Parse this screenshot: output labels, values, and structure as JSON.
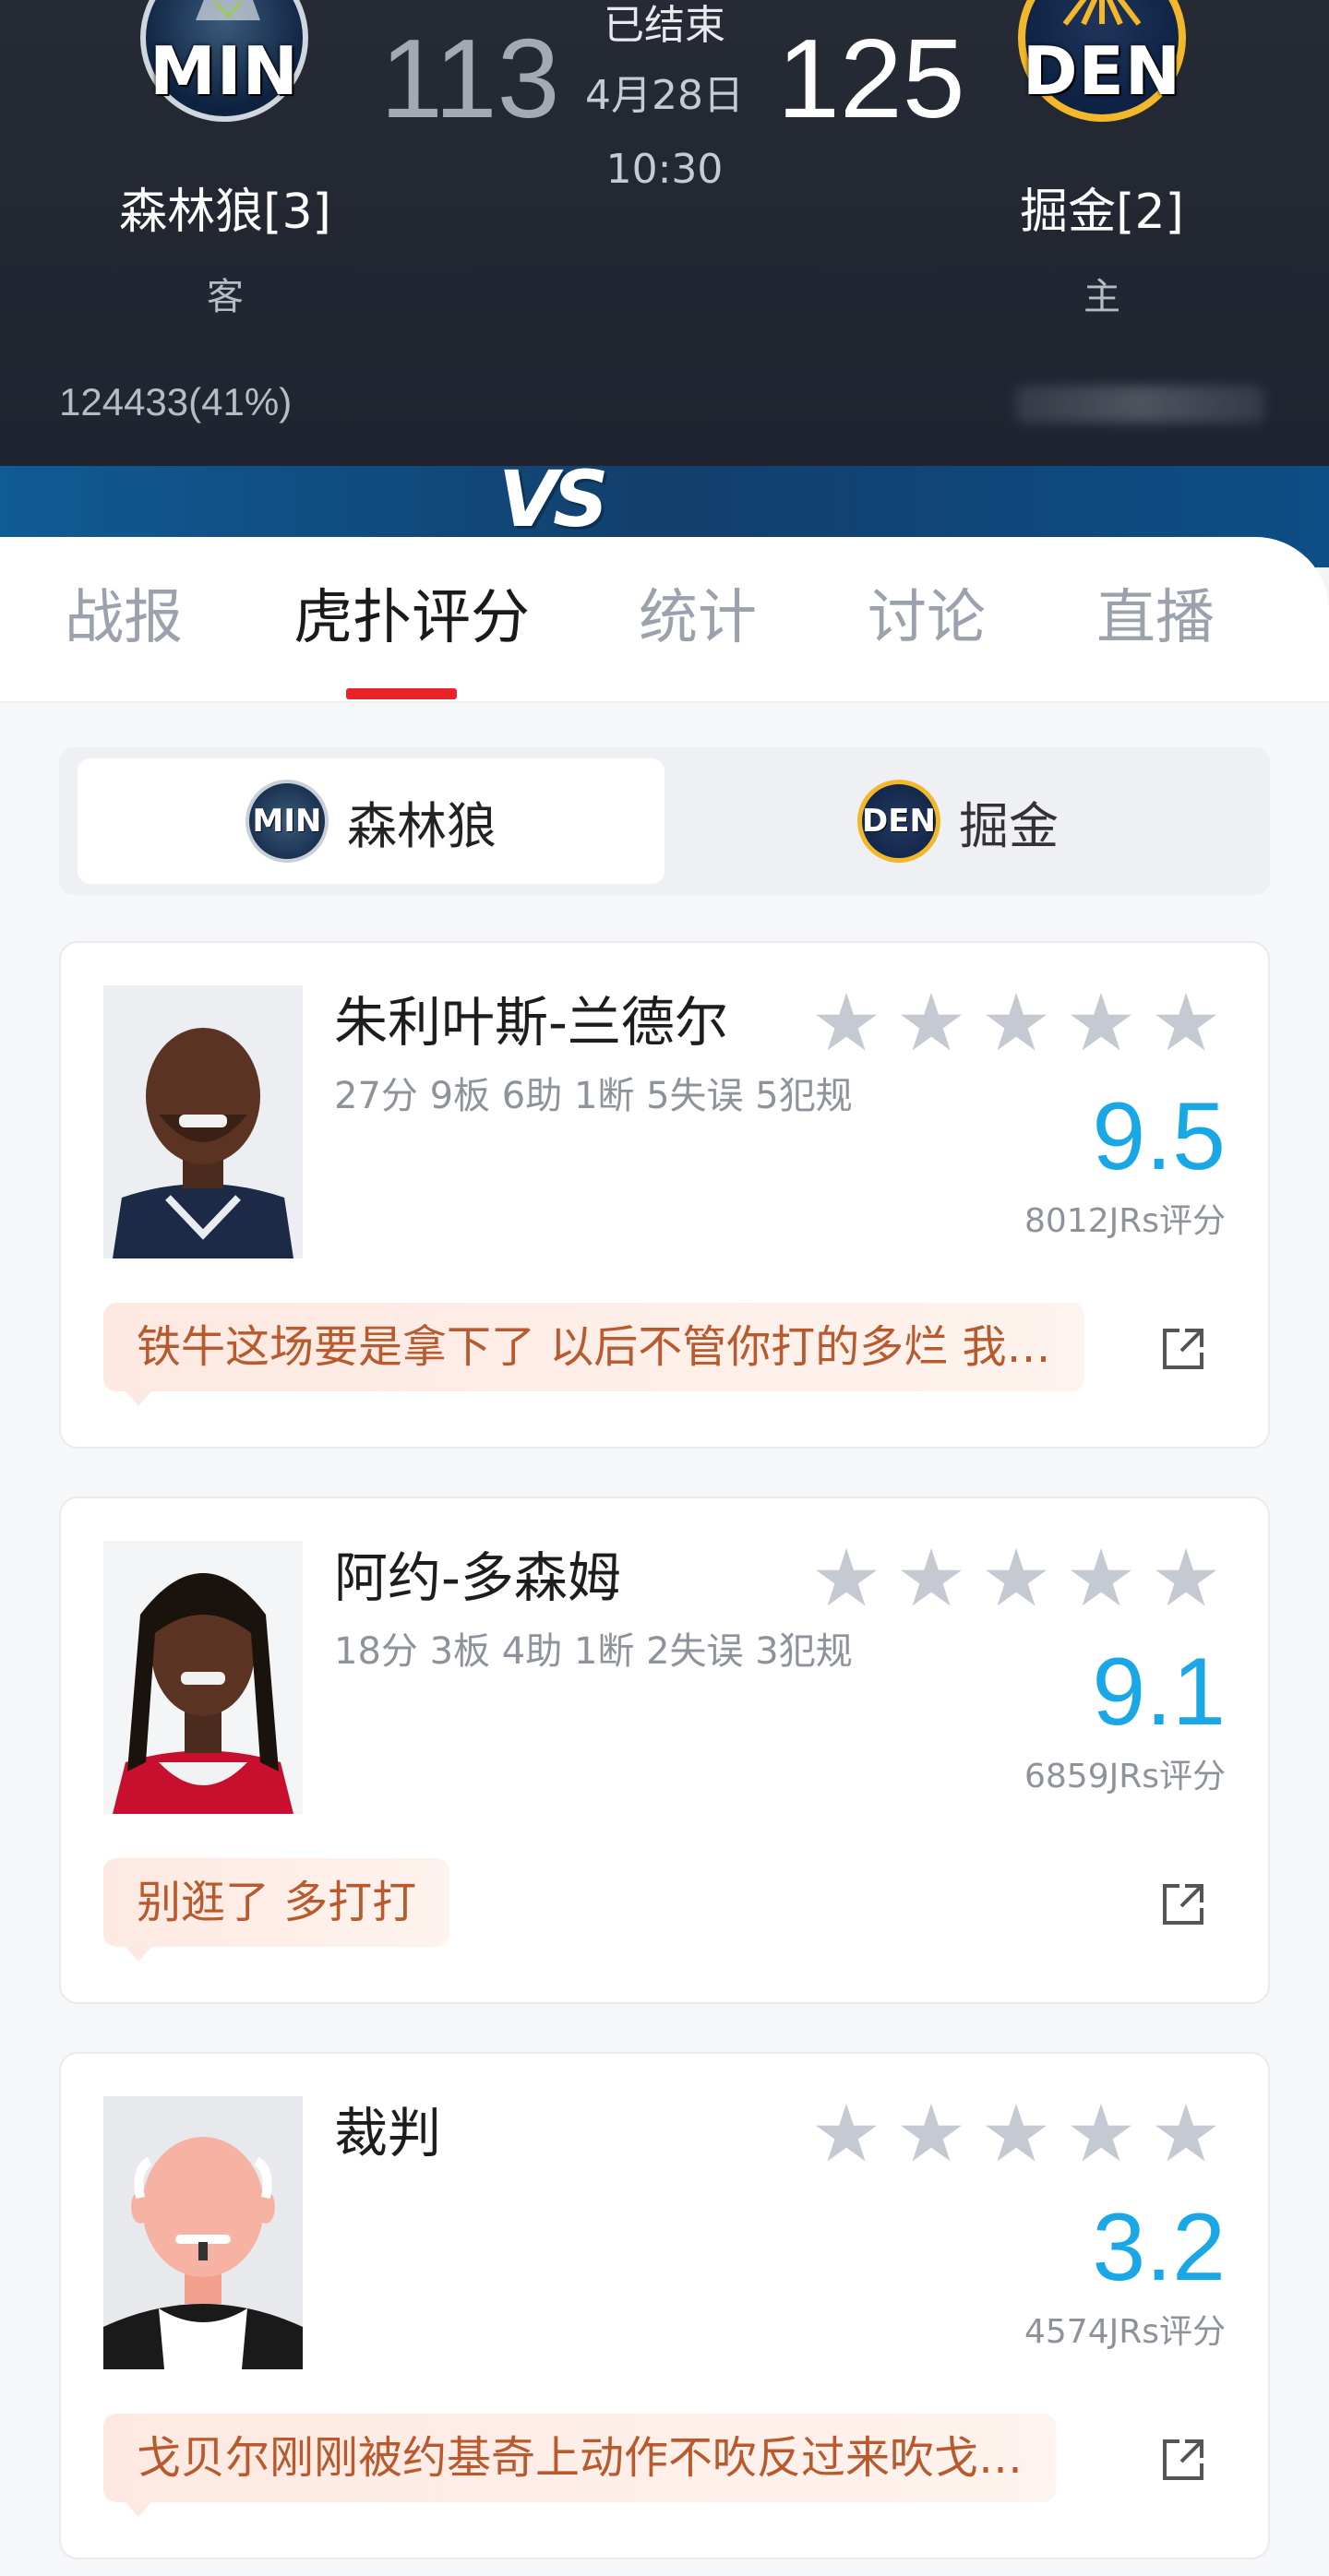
{
  "game": {
    "away": {
      "abbr": "MIN",
      "name": "森林狼[3]",
      "role": "客",
      "votes": "124433(41%)",
      "short": "森林狼"
    },
    "home": {
      "abbr": "DEN",
      "name": "掘金[2]",
      "role": "主",
      "short": "掘金"
    },
    "away_score": "113",
    "home_score": "125",
    "status": "已结束",
    "date": "4月28日",
    "time": "10:30",
    "vs": "VS"
  },
  "tabs": [
    "战报",
    "虎扑评分",
    "统计",
    "讨论",
    "直播"
  ],
  "active_tab": 1,
  "team_toggle": {
    "selected": "森林狼"
  },
  "players": [
    {
      "name": "朱利叶斯-兰德尔",
      "stats": "27分 9板 6助 1断 5失误 5犯规",
      "rating": "9.5",
      "count": "8012JRs评分",
      "comment": "铁牛这场要是拿下了 以后不管你打的多烂 我…"
    },
    {
      "name": "阿约-多森姆",
      "stats": "18分 3板 4助 1断 2失误 3犯规",
      "rating": "9.1",
      "count": "6859JRs评分",
      "comment": "别逛了 多打打"
    },
    {
      "name": "裁判",
      "stats": "",
      "rating": "3.2",
      "count": "4574JRs评分",
      "comment": "戈贝尔刚刚被约基奇上动作不吹反过来吹戈…"
    }
  ],
  "colors": {
    "rating": "#1aa7e6",
    "active_tab_underline": "#e8232a",
    "comment_text": "#b85a2e"
  },
  "icons": {
    "star": "star-icon",
    "share": "share-icon"
  }
}
